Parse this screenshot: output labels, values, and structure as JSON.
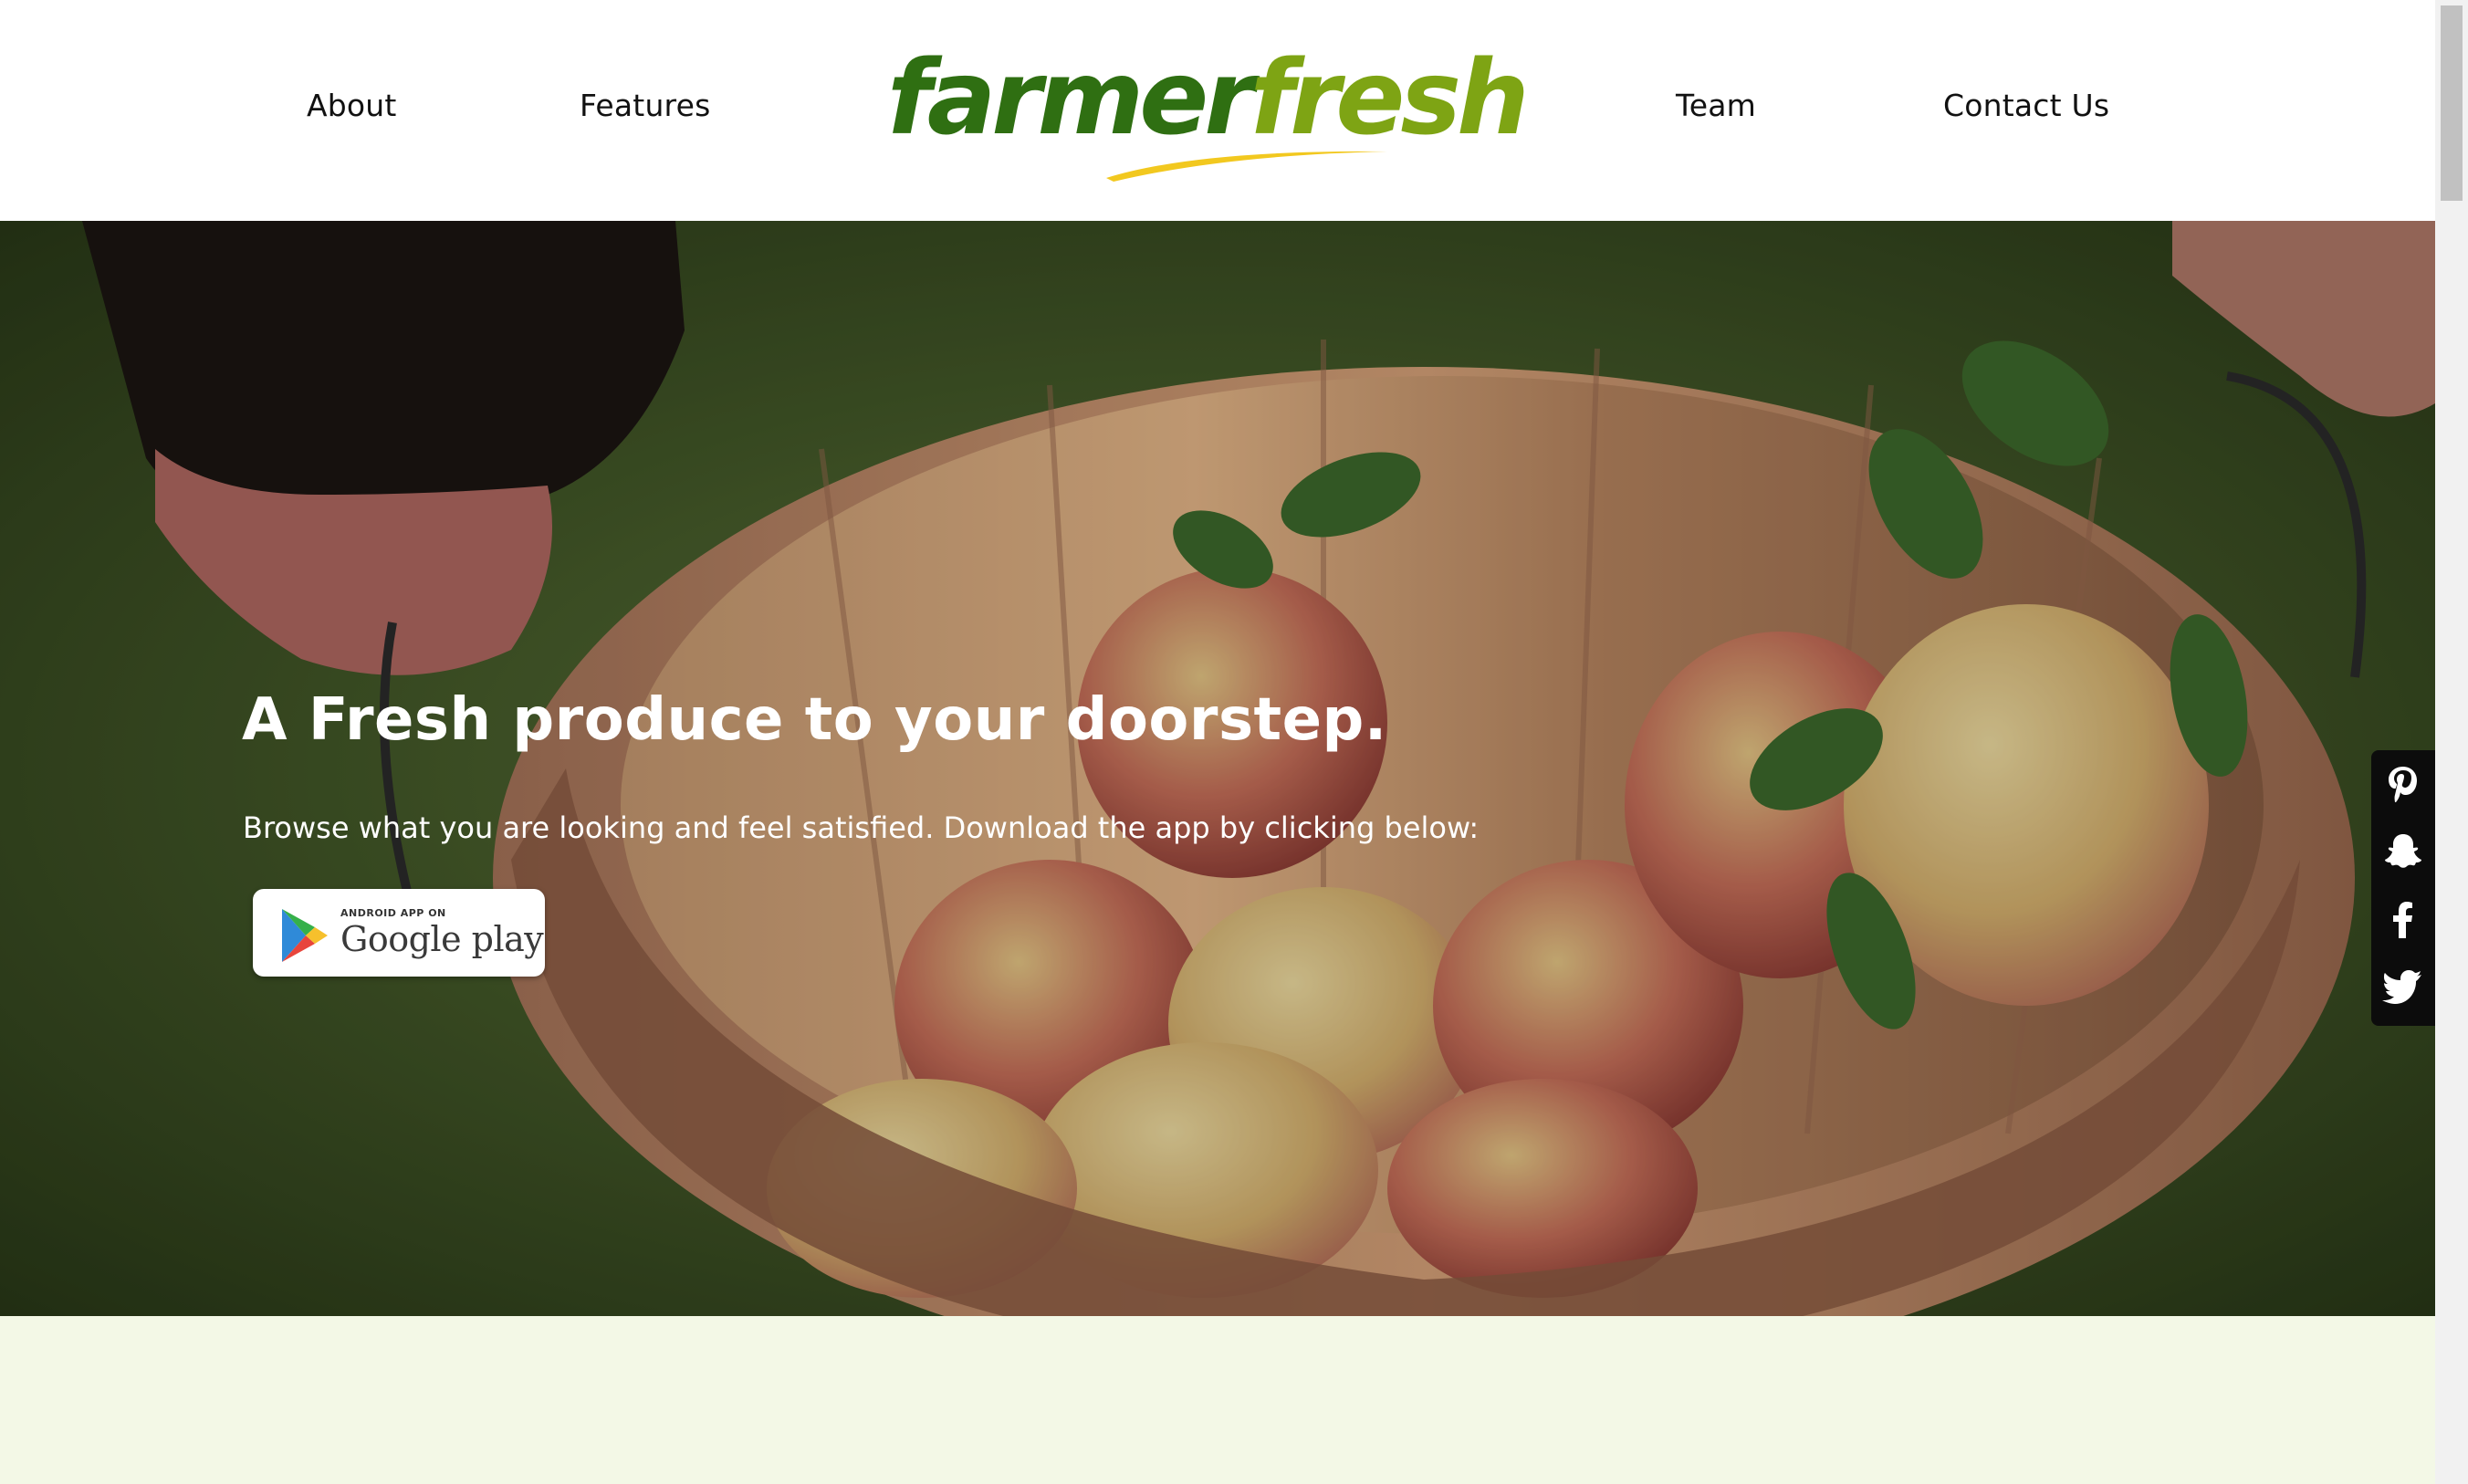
{
  "nav": {
    "about": "About",
    "features": "Features",
    "team": "Team",
    "contact": "Contact Us"
  },
  "logo": {
    "part1": "farmer",
    "part2": "fresh",
    "color_primary": "#2f6f12",
    "color_secondary": "#7ea414",
    "swoosh_color": "#f2c81f"
  },
  "hero": {
    "title": "A Fresh produce to your doorstep.",
    "subtitle": "Browse what you are looking and feel satisfied. Download the app by clicking below:",
    "badge_small": "ANDROID APP ON",
    "badge_big": "Google play"
  },
  "social": {
    "icons": [
      "pinterest-icon",
      "snapchat-icon",
      "facebook-icon",
      "twitter-icon"
    ]
  },
  "colors": {
    "lower_section": "#f3f8e6",
    "social_bar": "#0c0c0c"
  }
}
